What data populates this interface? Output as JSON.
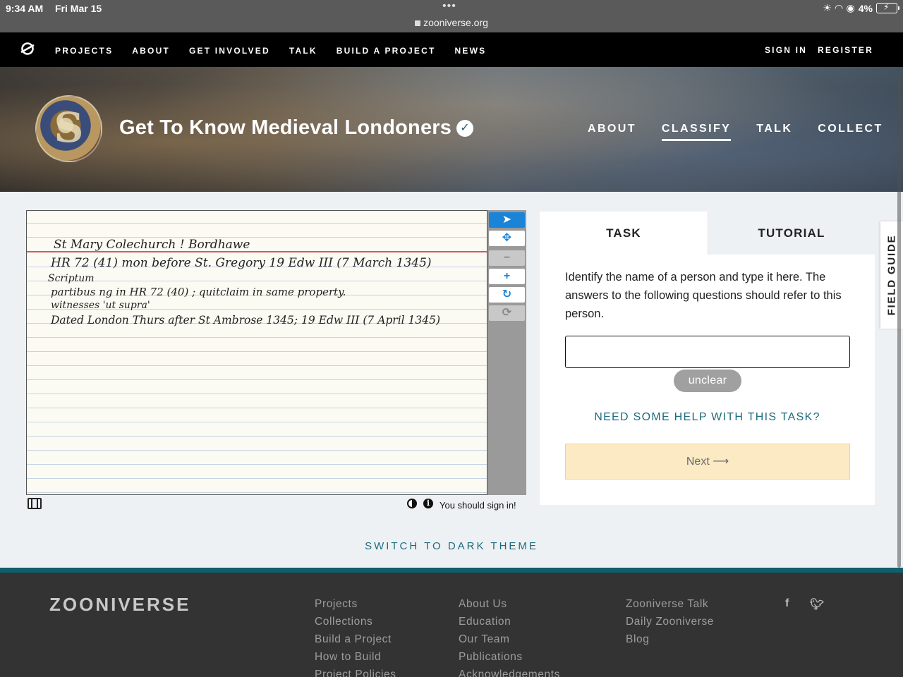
{
  "status_bar": {
    "time": "9:34 AM",
    "date": "Fri Mar 15",
    "url": "zooniverse.org",
    "battery": "4%"
  },
  "top_nav": {
    "links": [
      "PROJECTS",
      "ABOUT",
      "GET INVOLVED",
      "TALK",
      "BUILD A PROJECT",
      "NEWS"
    ],
    "sign_in": "SIGN IN",
    "register": "REGISTER"
  },
  "project": {
    "title": "Get To Know Medieval Londoners",
    "verified_icon": "check-circle-icon",
    "nav": [
      {
        "label": "ABOUT",
        "active": false
      },
      {
        "label": "CLASSIFY",
        "active": true
      },
      {
        "label": "TALK",
        "active": false
      },
      {
        "label": "COLLECT",
        "active": false
      }
    ]
  },
  "subject": {
    "handwritten_lines": [
      "St Mary Colechurch ! Bordhawe",
      "HR 72 (41)     mon before   St. Gregory   19 Edw III     (7 March 1345)",
      "Scriptum",
      "partibus  ng    in    HR 72 (40) ;  quitclaim  in  same  property.",
      "witnesses  'ut supra'",
      "Dated   London     Thurs  after  St  Ambrose  1345;  19 Edw III    (7 April 1345)"
    ]
  },
  "viewer_tools": [
    {
      "name": "pointer-icon",
      "glyph": "➤"
    },
    {
      "name": "move-icon",
      "glyph": "✥"
    },
    {
      "name": "zoom-out-icon",
      "glyph": "−"
    },
    {
      "name": "zoom-in-icon",
      "glyph": "+"
    },
    {
      "name": "rotate-icon",
      "glyph": "↻"
    },
    {
      "name": "reset-icon",
      "glyph": "⟳"
    }
  ],
  "viewer_footer": {
    "sign_in_message": "You should sign in!"
  },
  "task_panel": {
    "tab_task": "TASK",
    "tab_tutorial": "TUTORIAL",
    "question": "Identify the name of a person and type it here. The answers to the following questions should refer to this person.",
    "answer_value": "",
    "unclear_label": "unclear",
    "help_label": "NEED SOME HELP WITH THIS TASK?",
    "next_label": "Next ⟶"
  },
  "field_guide": "FIELD GUIDE",
  "dark_theme": "SWITCH TO DARK THEME",
  "footer": {
    "brand": "ZOONIVERSE",
    "col1": [
      "Projects",
      "Collections",
      "Build a Project",
      "How to Build",
      "Project Policies"
    ],
    "col2": [
      "About Us",
      "Education",
      "Our Team",
      "Publications",
      "Acknowledgements"
    ],
    "col3": [
      "Zooniverse Talk",
      "Daily Zooniverse",
      "Blog"
    ],
    "social": [
      "facebook-icon",
      "twitter-icon"
    ]
  },
  "colors": {
    "accent_teal": "#1c6b7e",
    "next_bg": "#fbeac3",
    "tool_blue": "#1a84d8"
  }
}
